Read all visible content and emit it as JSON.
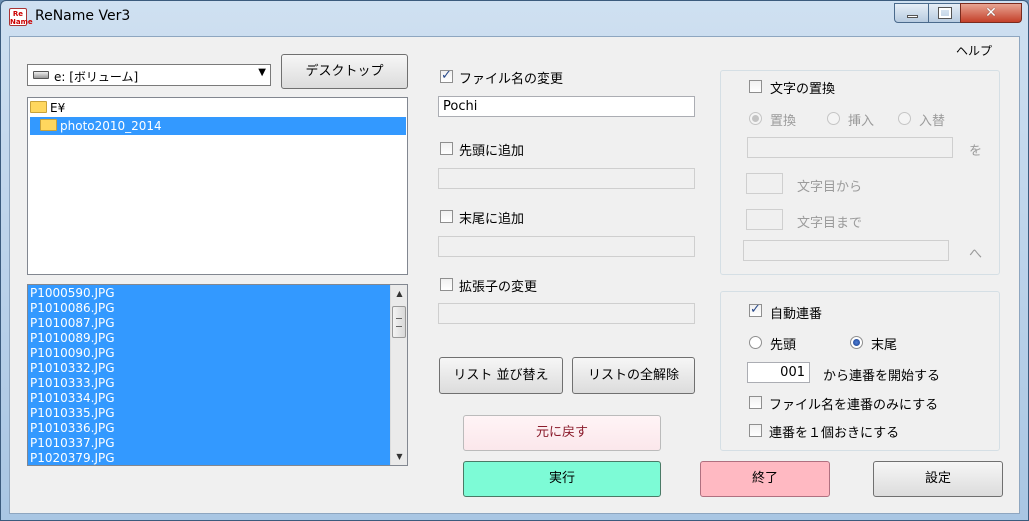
{
  "window": {
    "title": "ReName Ver3",
    "icon_label": "Re Name",
    "close_glyph": "✕"
  },
  "menu": {
    "help": "ヘルプ"
  },
  "drive": {
    "selected": "e: [ボリューム]",
    "arrow": "▼"
  },
  "buttons": {
    "desktop": "デスクトップ",
    "sort_list": "リスト 並び替え",
    "clear_list": "リストの全解除",
    "undo": "元に戻す",
    "execute": "実行",
    "exit": "終了",
    "settings": "設定"
  },
  "folder_tree": [
    {
      "label": "E¥",
      "selected": false
    },
    {
      "label": "photo2010_2014",
      "selected": true
    }
  ],
  "files": [
    "P1000590.JPG",
    "P1010086.JPG",
    "P1010087.JPG",
    "P1010089.JPG",
    "P1010090.JPG",
    "P1010332.JPG",
    "P1010333.JPG",
    "P1010334.JPG",
    "P1010335.JPG",
    "P1010336.JPG",
    "P1010337.JPG",
    "P1020379.JPG"
  ],
  "scroll": {
    "up": "▲",
    "down": "▼"
  },
  "options": {
    "change_name": {
      "label": "ファイル名の変更",
      "checked": true,
      "value": "Pochi"
    },
    "add_prefix": {
      "label": "先頭に追加",
      "checked": false,
      "value": ""
    },
    "add_suffix": {
      "label": "末尾に追加",
      "checked": false,
      "value": ""
    },
    "change_ext": {
      "label": "拡張子の変更",
      "checked": false,
      "value": ""
    }
  },
  "replace": {
    "label": "文字の置換",
    "checked": false,
    "modes": [
      "置換",
      "挿入",
      "入替"
    ],
    "selected_mode": 0,
    "wo": "を",
    "from_label": "文字目から",
    "to_label": "文字目まで",
    "he": "へ"
  },
  "numbering": {
    "label": "自動連番",
    "checked": true,
    "position_options": [
      "先頭",
      "末尾"
    ],
    "selected_position": 1,
    "start_value": "001",
    "start_label": "から連番を開始する",
    "only_number": "ファイル名を連番のみにする",
    "every_other": "連番を１個おきにする"
  }
}
